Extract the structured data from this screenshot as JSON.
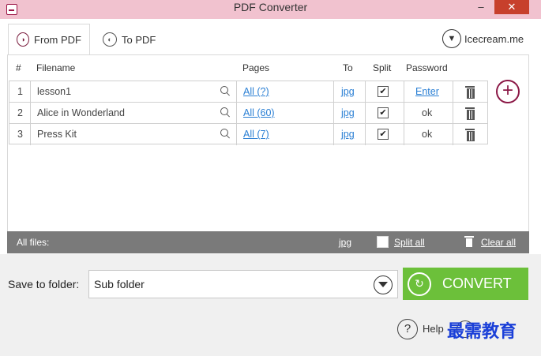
{
  "window": {
    "title": "PDF Converter",
    "minimize": "–",
    "close": "✕"
  },
  "tabs": [
    {
      "label": "From PDF",
      "icon": "pdf-out-icon",
      "active": true
    },
    {
      "label": "To PDF",
      "icon": "pdf-in-icon",
      "active": false
    }
  ],
  "brand": {
    "label": "Icecream.me",
    "icon": "icecream-logo-icon"
  },
  "table": {
    "headers": {
      "num": "#",
      "filename": "Filename",
      "pages": "Pages",
      "to": "To",
      "split": "Split",
      "password": "Password"
    },
    "rows": [
      {
        "num": "1",
        "filename": "lesson1",
        "pages": "All (?)",
        "to": "jpg",
        "split": "✔",
        "password": "Enter"
      },
      {
        "num": "2",
        "filename": "Alice in Wonderland",
        "pages": "All (60)",
        "to": "jpg",
        "split": "✔",
        "password": "ok"
      },
      {
        "num": "3",
        "filename": "Press Kit",
        "pages": "All (7)",
        "to": "jpg",
        "split": "✔",
        "password": "ok"
      }
    ]
  },
  "add_button": {
    "label": "+"
  },
  "all_files": {
    "label": "All files:",
    "to": "jpg",
    "split_label": "Split all",
    "clear_label": "Clear all"
  },
  "save": {
    "label": "Save to folder:",
    "value": "Sub folder"
  },
  "convert": {
    "label": "CONVERT",
    "icon": "refresh-icon"
  },
  "help": {
    "icon_glyph": "?",
    "label": "Help"
  },
  "watermark": {
    "text": "最需教育"
  },
  "colors": {
    "accent": "#8b1846",
    "convert_green": "#6cc03a",
    "link_blue": "#2a7fd4",
    "bar_gray": "#7a7a7a"
  }
}
